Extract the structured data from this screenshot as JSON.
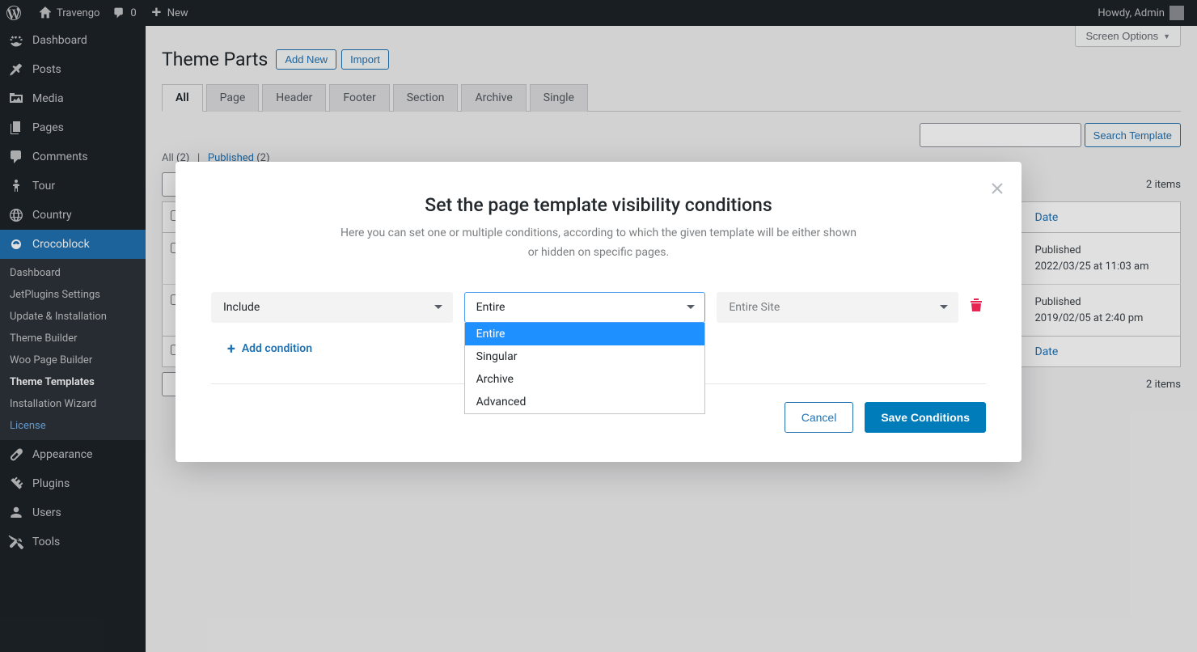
{
  "admin_bar": {
    "site_name": "Travengo",
    "comments": "0",
    "new": "New",
    "howdy": "Howdy, Admin"
  },
  "sidebar": {
    "dashboard": "Dashboard",
    "posts": "Posts",
    "media": "Media",
    "pages": "Pages",
    "comments": "Comments",
    "tour": "Tour",
    "country": "Country",
    "crocoblock": "Crocoblock",
    "appearance": "Appearance",
    "plugins": "Plugins",
    "users": "Users",
    "tools": "Tools",
    "sub": {
      "dashboard": "Dashboard",
      "jetplugins": "JetPlugins Settings",
      "update": "Update & Installation",
      "theme_builder": "Theme Builder",
      "woo": "Woo Page Builder",
      "theme_templates": "Theme Templates",
      "wizard": "Installation Wizard",
      "license": "License"
    }
  },
  "page": {
    "screen_options": "Screen Options",
    "title": "Theme Parts",
    "add_new": "Add New",
    "import": "Import",
    "tabs": [
      "All",
      "Page",
      "Header",
      "Footer",
      "Section",
      "Archive",
      "Single"
    ],
    "filters": {
      "all_label": "All",
      "all_count": "(2)",
      "sep": "|",
      "published_label": "Published",
      "published_count": "(2)"
    },
    "search_btn": "Search Template",
    "items_count": "2 items",
    "columns": {
      "date": "Date"
    },
    "rows": [
      {
        "status": "Published",
        "date": "2022/03/25 at 11:03 am"
      },
      {
        "status": "Published",
        "date": "2019/02/05 at 2:40 pm"
      }
    ]
  },
  "modal": {
    "title": "Set the page template visibility conditions",
    "subtitle": "Here you can set one or multiple conditions, according to which the given template will be either shown or hidden on specific pages.",
    "include": "Include",
    "entire": "Entire",
    "entire_site": "Entire Site",
    "options": [
      "Entire",
      "Singular",
      "Archive",
      "Advanced"
    ],
    "add_condition": "Add condition",
    "cancel": "Cancel",
    "save": "Save Conditions"
  }
}
